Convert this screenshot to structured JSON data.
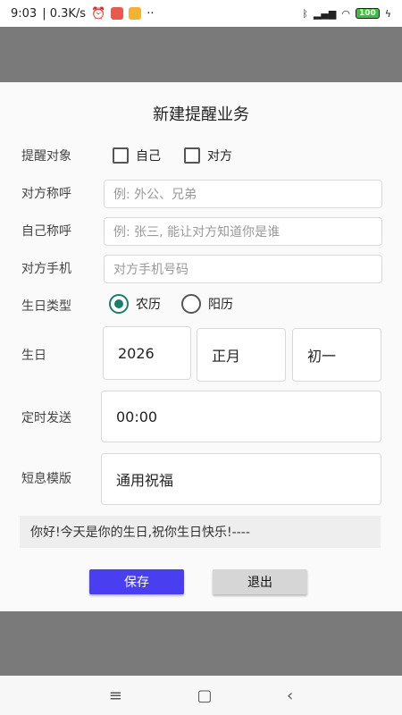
{
  "status_bar": {
    "time": "9:03",
    "net_speed": "| 0.3K/s",
    "dots": "··",
    "battery": "100"
  },
  "dialog": {
    "title": "新建提醒业务",
    "target": {
      "label": "提醒对象",
      "options": [
        "自己",
        "对方"
      ],
      "checked": [
        false,
        false
      ]
    },
    "other_name": {
      "label": "对方称呼",
      "placeholder": "例: 外公、兄弟"
    },
    "self_name": {
      "label": "自己称呼",
      "placeholder": "例: 张三, 能让对方知道你是谁"
    },
    "other_phone": {
      "label": "对方手机",
      "placeholder": "对方手机号码"
    },
    "birthday_type": {
      "label": "生日类型",
      "options": [
        "农历",
        "阳历"
      ],
      "selected": "农历"
    },
    "birthday": {
      "label": "生日",
      "year": "2026",
      "month": "正月",
      "day": "初一"
    },
    "schedule": {
      "label": "定时发送",
      "time": "00:00"
    },
    "template": {
      "label": "短息模版",
      "value": "通用祝福"
    },
    "message_preview": "你好!今天是你的生日,祝你生日快乐!----",
    "save_label": "保存",
    "exit_label": "退出"
  },
  "colors": {
    "primary_button": "#4a3ff0",
    "radio_accent": "#1a7f6a"
  }
}
